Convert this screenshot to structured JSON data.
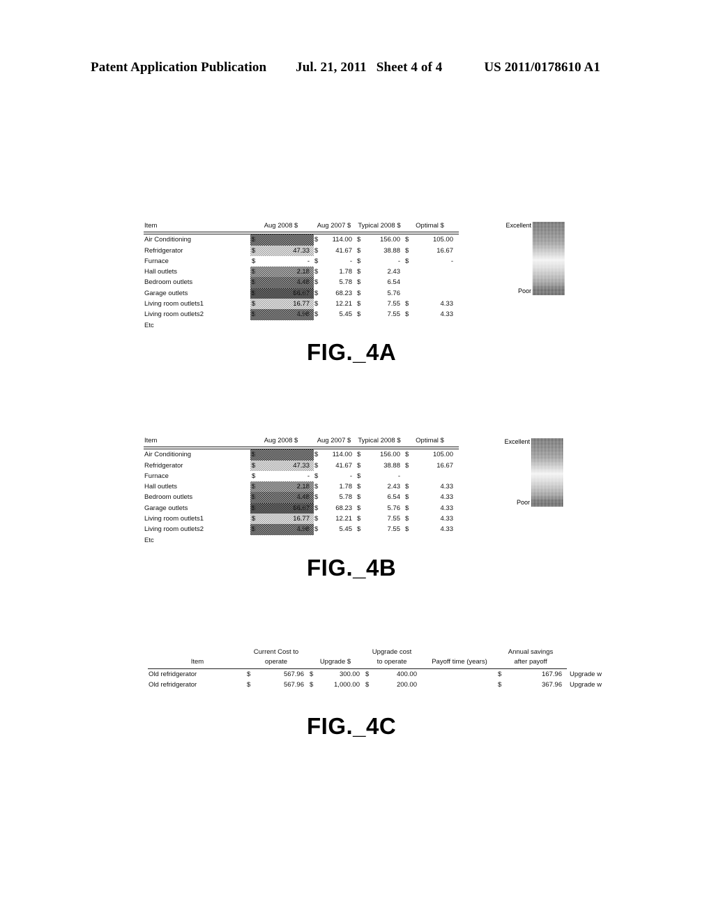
{
  "header": {
    "publication": "Patent Application Publication",
    "date": "Jul. 21, 2011",
    "sheet": "Sheet 4 of 4",
    "patent_number": "US 2011/0178610 A1"
  },
  "captions": {
    "fig_4a": "FIG._4A",
    "fig_4b": "FIG._4B",
    "fig_4c": "FIG._4C"
  },
  "legend": {
    "top_label": "Excellent",
    "bottom_label": "Poor",
    "gradient_top_color": "#2f2f2f",
    "gradient_mid_color": "#ededed",
    "gradient_bottom_color": "#2b2b2b"
  },
  "fig_4a": {
    "columns": [
      "Item",
      "Aug 2008 $",
      "Aug 2007 $",
      "Typical 2008 $",
      "Optimal $"
    ],
    "rows": [
      {
        "item": "Air Conditioning",
        "aug2008": {
          "sym": "$",
          "value": "",
          "shade": 4
        },
        "aug2007": {
          "sym": "$",
          "value": "114.00"
        },
        "typical": {
          "sym": "$",
          "value": "156.00"
        },
        "optimal": {
          "sym": "$",
          "value": "105.00"
        }
      },
      {
        "item": "Refridgerator",
        "aug2008": {
          "sym": "$",
          "value": "47.33",
          "shade": 1
        },
        "aug2007": {
          "sym": "$",
          "value": "41.67"
        },
        "typical": {
          "sym": "$",
          "value": "38.88"
        },
        "optimal": {
          "sym": "$",
          "value": "16.67"
        }
      },
      {
        "item": "Furnace",
        "aug2008": {
          "sym": "$",
          "value": "-",
          "shade": 0
        },
        "aug2007": {
          "sym": "$",
          "value": "-"
        },
        "typical": {
          "sym": "$",
          "value": "-"
        },
        "optimal": {
          "sym": "$",
          "value": "-"
        }
      },
      {
        "item": "Hall outlets",
        "aug2008": {
          "sym": "$",
          "value": "2.18",
          "shade": 3
        },
        "aug2007": {
          "sym": "$",
          "value": "1.78"
        },
        "typical": {
          "sym": "$",
          "value": "2.43"
        },
        "optimal": {
          "sym": "",
          "value": ""
        }
      },
      {
        "item": "Bedroom outlets",
        "aug2008": {
          "sym": "$",
          "value": "4.48",
          "shade": 4
        },
        "aug2007": {
          "sym": "$",
          "value": "5.78"
        },
        "typical": {
          "sym": "$",
          "value": "6.54"
        },
        "optimal": {
          "sym": "",
          "value": ""
        }
      },
      {
        "item": "Garage outlets",
        "aug2008": {
          "sym": "$",
          "value": "66.67",
          "shade": 5
        },
        "aug2007": {
          "sym": "$",
          "value": "68.23"
        },
        "typical": {
          "sym": "$",
          "value": "5.76"
        },
        "optimal": {
          "sym": "",
          "value": ""
        }
      },
      {
        "item": "Living room outlets1",
        "aug2008": {
          "sym": "$",
          "value": "16.77",
          "shade": 1
        },
        "aug2007": {
          "sym": "$",
          "value": "12.21"
        },
        "typical": {
          "sym": "$",
          "value": "7.55"
        },
        "optimal": {
          "sym": "$",
          "value": "4.33"
        }
      },
      {
        "item": "Living room outlets2",
        "aug2008": {
          "sym": "$",
          "value": "4.98",
          "shade": 4
        },
        "aug2007": {
          "sym": "$",
          "value": "5.45"
        },
        "typical": {
          "sym": "$",
          "value": "7.55"
        },
        "optimal": {
          "sym": "$",
          "value": "4.33"
        }
      },
      {
        "item": "Etc",
        "aug2008": {
          "sym": "",
          "value": "",
          "shade": 0
        },
        "aug2007": {
          "sym": "",
          "value": ""
        },
        "typical": {
          "sym": "",
          "value": ""
        },
        "optimal": {
          "sym": "",
          "value": ""
        }
      }
    ]
  },
  "fig_4b": {
    "columns": [
      "Item",
      "Aug 2008 $",
      "Aug 2007 $",
      "Typical 2008 $",
      "Optimal $"
    ],
    "rows": [
      {
        "item": "Air Conditioning",
        "aug2008": {
          "sym": "$",
          "value": "",
          "shade": 4
        },
        "aug2007": {
          "sym": "$",
          "value": "114.00"
        },
        "typical": {
          "sym": "$",
          "value": "156.00"
        },
        "optimal": {
          "sym": "$",
          "value": "105.00"
        }
      },
      {
        "item": "Refridgerator",
        "aug2008": {
          "sym": "$",
          "value": "47.33",
          "shade": 1
        },
        "aug2007": {
          "sym": "$",
          "value": "41.67"
        },
        "typical": {
          "sym": "$",
          "value": "38.88"
        },
        "optimal": {
          "sym": "$",
          "value": "16.67"
        }
      },
      {
        "item": "Furnace",
        "aug2008": {
          "sym": "$",
          "value": "-",
          "shade": 0
        },
        "aug2007": {
          "sym": "$",
          "value": "-"
        },
        "typical": {
          "sym": "$",
          "value": "-"
        },
        "optimal": {
          "sym": "",
          "value": ""
        }
      },
      {
        "item": "Hall outlets",
        "aug2008": {
          "sym": "$",
          "value": "2.18",
          "shade": 3
        },
        "aug2007": {
          "sym": "$",
          "value": "1.78"
        },
        "typical": {
          "sym": "$",
          "value": "2.43"
        },
        "optimal": {
          "sym": "$",
          "value": "4.33"
        }
      },
      {
        "item": "Bedroom outlets",
        "aug2008": {
          "sym": "$",
          "value": "4.48",
          "shade": 4
        },
        "aug2007": {
          "sym": "$",
          "value": "5.78"
        },
        "typical": {
          "sym": "$",
          "value": "6.54"
        },
        "optimal": {
          "sym": "$",
          "value": "4.33"
        }
      },
      {
        "item": "Garage outlets",
        "aug2008": {
          "sym": "$",
          "value": "66.67",
          "shade": 5
        },
        "aug2007": {
          "sym": "$",
          "value": "68.23"
        },
        "typical": {
          "sym": "$",
          "value": "5.76"
        },
        "optimal": {
          "sym": "$",
          "value": "4.33"
        }
      },
      {
        "item": "Living room outlets1",
        "aug2008": {
          "sym": "$",
          "value": "16.77",
          "shade": 1
        },
        "aug2007": {
          "sym": "$",
          "value": "12.21"
        },
        "typical": {
          "sym": "$",
          "value": "7.55"
        },
        "optimal": {
          "sym": "$",
          "value": "4.33"
        }
      },
      {
        "item": "Living room outlets2",
        "aug2008": {
          "sym": "$",
          "value": "4.98",
          "shade": 4
        },
        "aug2007": {
          "sym": "$",
          "value": "5.45"
        },
        "typical": {
          "sym": "$",
          "value": "7.55"
        },
        "optimal": {
          "sym": "$",
          "value": "4.33"
        }
      },
      {
        "item": "Etc",
        "aug2008": {
          "sym": "",
          "value": "",
          "shade": 0
        },
        "aug2007": {
          "sym": "",
          "value": ""
        },
        "typical": {
          "sym": "",
          "value": ""
        },
        "optimal": {
          "sym": "",
          "value": ""
        }
      }
    ]
  },
  "fig_4c": {
    "columns_line1": [
      "",
      "Current Cost to",
      "",
      "Upgrade cost",
      "",
      "Annual savings",
      ""
    ],
    "columns_line2": [
      "Item",
      "operate",
      "Upgrade $",
      "to operate",
      "Payoff time (years)",
      "after payoff",
      ""
    ],
    "rows": [
      {
        "item": "Old refridgerator",
        "current_cost": {
          "sym": "$",
          "value": "567.96"
        },
        "upgrade_cost": {
          "sym": "$",
          "value": "300.00"
        },
        "upgrade_operate": {
          "sym": "$",
          "value": "400.00"
        },
        "payoff_time": "",
        "annual_savings": {
          "sym": "$",
          "value": "167.96"
        },
        "note": "Upgrade w"
      },
      {
        "item": "Old refridgerator",
        "current_cost": {
          "sym": "$",
          "value": "567.96"
        },
        "upgrade_cost": {
          "sym": "$",
          "value": "1,000.00"
        },
        "upgrade_operate": {
          "sym": "$",
          "value": "200.00"
        },
        "payoff_time": "",
        "annual_savings": {
          "sym": "$",
          "value": "367.96"
        },
        "note": "Upgrade w"
      }
    ]
  }
}
